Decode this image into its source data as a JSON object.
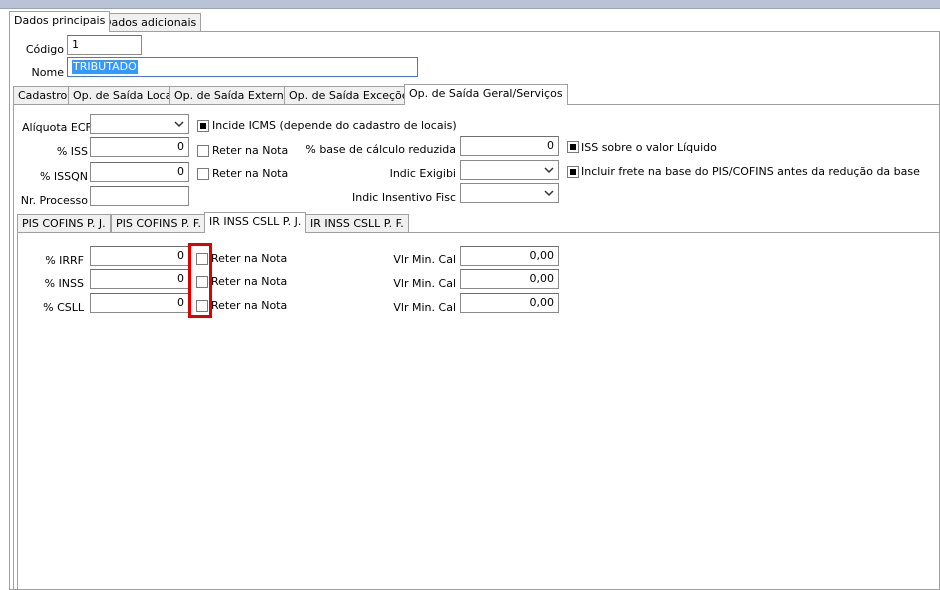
{
  "main_tabs": [
    "Dados principais",
    "Dados adicionais"
  ],
  "codigo": {
    "label": "Código",
    "value": "1"
  },
  "nome": {
    "label": "Nome",
    "value": "TRIBUTADO"
  },
  "section_tabs": [
    "Cadastro",
    "Op. de Saída Local",
    "Op. de Saída Externa",
    "Op. de Saída Exceções",
    "Op. de Saída Geral/Serviços"
  ],
  "form": {
    "aliquota_ecf": {
      "label": "Alíquota ECF",
      "value": ""
    },
    "incide_icms": {
      "label": "Incide ICMS (depende do cadastro de locais)",
      "checked": true
    },
    "iss": {
      "label": "% ISS",
      "value": "0",
      "reter_label": "Reter na Nota",
      "reter_checked": false
    },
    "issqn": {
      "label": "% ISSQN",
      "value": "0",
      "reter_label": "Reter na Nota",
      "reter_checked": false
    },
    "nr_processo": {
      "label": "Nr. Processo",
      "value": ""
    },
    "base_reduzida": {
      "label": "% base de cálculo reduzida",
      "value": "0"
    },
    "indic_exigibi": {
      "label": "Indic Exigibi",
      "value": ""
    },
    "indic_insentivo": {
      "label": "Indic Insentivo Fisc",
      "value": ""
    },
    "iss_valor_liquido": {
      "label": "ISS sobre o valor Líquido",
      "checked": true
    },
    "incluir_frete": {
      "label": "Incluir frete na base do PIS/COFINS antes da redução da base",
      "checked": true
    }
  },
  "sub_tabs": [
    "PIS COFINS P. J.",
    "PIS COFINS P. F.",
    "IR INSS CSLL P. J.",
    "IR INSS CSLL P. F."
  ],
  "retencoes": [
    {
      "label": "% IRRF",
      "value": "0",
      "reter_label": "Reter na Nota",
      "reter_checked": false,
      "vlr_label": "Vlr Min. Cal",
      "vlr_value": "0,00"
    },
    {
      "label": "% INSS",
      "value": "0",
      "reter_label": "Reter na Nota",
      "reter_checked": false,
      "vlr_label": "Vlr Min. Cal",
      "vlr_value": "0,00"
    },
    {
      "label": "% CSLL",
      "value": "0",
      "reter_label": "Reter na Nota",
      "reter_checked": false,
      "vlr_label": "Vlr Min. Cal",
      "vlr_value": "0,00"
    }
  ],
  "colors": {
    "highlight": "#e00000",
    "selection": "#3399ff",
    "topbar": "#b9c2d6"
  },
  "icons": {
    "combo_arrow": "chevron-down-icon"
  }
}
